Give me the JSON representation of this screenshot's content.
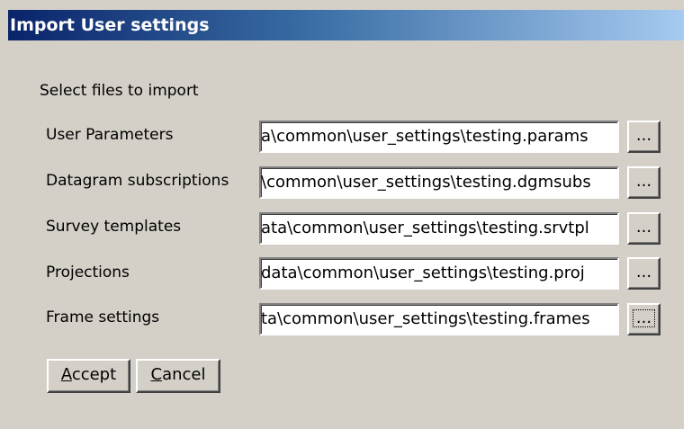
{
  "window": {
    "title": "Import User settings"
  },
  "section": {
    "label": "Select files to import"
  },
  "rows": [
    {
      "label": "User Parameters",
      "value": "a\\common\\user_settings\\testing.params",
      "button": "..."
    },
    {
      "label": "Datagram subscriptions",
      "value": "\\common\\user_settings\\testing.dgmsubs",
      "button": "..."
    },
    {
      "label": "Survey templates",
      "value": "ata\\common\\user_settings\\testing.srvtpl",
      "button": "..."
    },
    {
      "label": "Projections",
      "value": "data\\common\\user_settings\\testing.proj",
      "button": "..."
    },
    {
      "label": "Frame settings",
      "value": "ta\\common\\user_settings\\testing.frames",
      "button": "..."
    }
  ],
  "buttons": {
    "accept_accel": "A",
    "accept_rest": "ccept",
    "cancel_accel": "C",
    "cancel_rest": "ancel"
  },
  "colors": {
    "dialog_bg": "#d4d0c8",
    "titlebar_start": "#0a246a",
    "titlebar_end": "#a6caf0"
  }
}
